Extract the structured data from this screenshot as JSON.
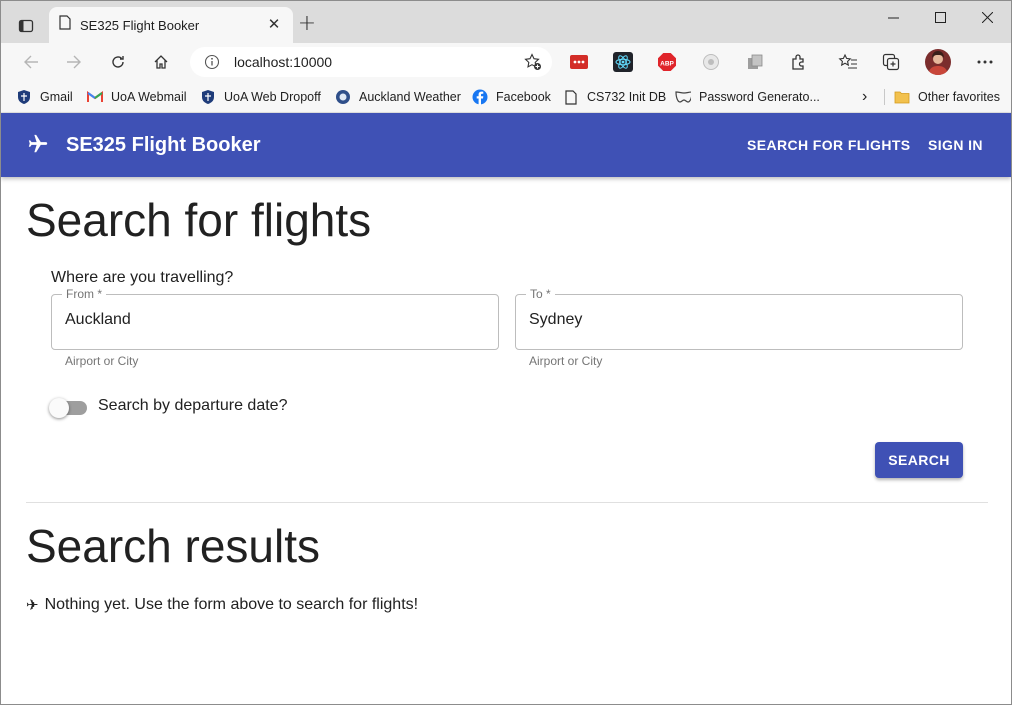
{
  "browser": {
    "tab_title": "SE325 Flight Booker",
    "tab_close": "✕",
    "new_tab": "+",
    "url": "localhost:10000",
    "bookmarks": [
      {
        "label": "Gmail",
        "icon": "shield-icon"
      },
      {
        "label": "UoA Webmail",
        "icon": "gmail-icon"
      },
      {
        "label": "UoA Web Dropoff",
        "icon": "shield-icon"
      },
      {
        "label": "Auckland Weather",
        "icon": "weather-icon"
      },
      {
        "label": "Facebook",
        "icon": "facebook-icon"
      },
      {
        "label": "CS732 Init DB",
        "icon": "page-icon"
      },
      {
        "label": "Password Generato...",
        "icon": "mask-icon"
      }
    ],
    "other_favorites": "Other favorites",
    "more_bookmarks": "›",
    "colors": {
      "tabstrip": "#dcdcdc",
      "toolbar": "#f7f7f7"
    }
  },
  "appbar": {
    "brand": "SE325 Flight Booker",
    "nav_search": "SEARCH FOR FLIGHTS",
    "nav_signin": "SIGN IN",
    "color": "#3f51b5"
  },
  "search": {
    "heading": "Search for flights",
    "subtitle": "Where are you travelling?",
    "from_label": "From *",
    "from_value": "Auckland",
    "from_helper": "Airport or City",
    "to_label": "To *",
    "to_value": "Sydney",
    "to_helper": "Airport or City",
    "date_toggle_label": "Search by departure date?",
    "date_toggle_on": false,
    "button": "SEARCH"
  },
  "results": {
    "heading": "Search results",
    "icon": "✈",
    "message": "Nothing yet. Use the form above to search for flights!"
  }
}
